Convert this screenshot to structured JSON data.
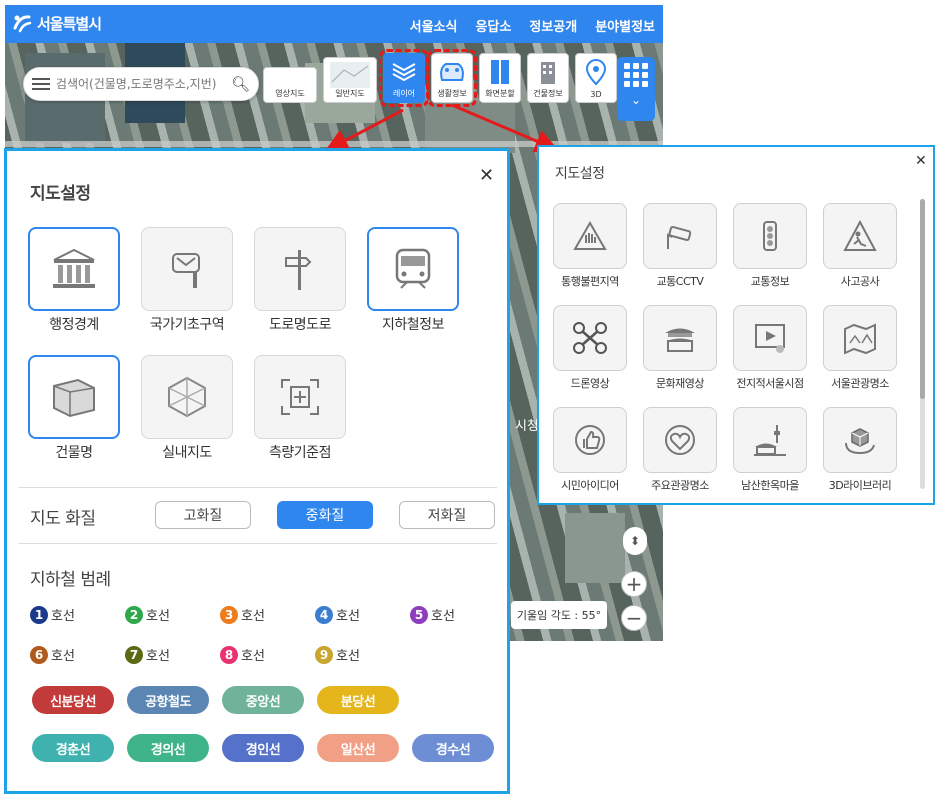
{
  "app": {
    "logo_text": "서울특별시",
    "nav": [
      "서울소식",
      "응답소",
      "정보공개",
      "분야별정보"
    ],
    "search_placeholder": "검색어(건물명,도로명주소,지번)",
    "map_buttons": [
      {
        "label": "영상지도"
      },
      {
        "label": "일반지도"
      },
      {
        "label": "레이어"
      },
      {
        "label": "생활정보"
      },
      {
        "label": "화면분할"
      },
      {
        "label": "건물정보"
      },
      {
        "label": "3D"
      }
    ],
    "tilt_label": "기울임 각도 : 55°",
    "map_text": "시청삼"
  },
  "left_panel": {
    "title": "지도설정",
    "layers": [
      {
        "label": "행정경계",
        "icon": "building-columns-icon",
        "selected": true
      },
      {
        "label": "국가기초구역",
        "icon": "mailbox-icon",
        "selected": false
      },
      {
        "label": "도로명도로",
        "icon": "signpost-icon",
        "selected": false
      },
      {
        "label": "지하철정보",
        "icon": "subway-icon",
        "selected": true
      },
      {
        "label": "건물명",
        "icon": "building-3d-icon",
        "selected": true
      },
      {
        "label": "실내지도",
        "icon": "indoor-cube-icon",
        "selected": false
      },
      {
        "label": "측량기준점",
        "icon": "survey-point-icon",
        "selected": false
      }
    ],
    "quality_title": "지도 화질",
    "quality_options": [
      "고화질",
      "중화질",
      "저화질"
    ],
    "quality_selected": "중화질",
    "legend_title": "지하철 범례",
    "numbered_lines": [
      {
        "num": "1",
        "label": "호선",
        "color": "#1b3a8c"
      },
      {
        "num": "2",
        "label": "호선",
        "color": "#2ea84a"
      },
      {
        "num": "3",
        "label": "호선",
        "color": "#ef7c1c"
      },
      {
        "num": "4",
        "label": "호선",
        "color": "#3b7ed0"
      },
      {
        "num": "5",
        "label": "호선",
        "color": "#8e3dbd"
      },
      {
        "num": "6",
        "label": "호선",
        "color": "#b05a1e"
      },
      {
        "num": "7",
        "label": "호선",
        "color": "#5b6a14"
      },
      {
        "num": "8",
        "label": "호선",
        "color": "#e8336f"
      },
      {
        "num": "9",
        "label": "호선",
        "color": "#c9a62e"
      }
    ],
    "named_lines": [
      {
        "label": "신분당선",
        "color": "#c23a3a"
      },
      {
        "label": "공항철도",
        "color": "#5b86b4"
      },
      {
        "label": "중앙선",
        "color": "#6fb49a"
      },
      {
        "label": "분당선",
        "color": "#e5b51c"
      },
      {
        "label": "경춘선",
        "color": "#3fb2b0"
      },
      {
        "label": "경의선",
        "color": "#3fb489"
      },
      {
        "label": "경인선",
        "color": "#5571c9"
      },
      {
        "label": "일산선",
        "color": "#f2a085"
      },
      {
        "label": "경수선",
        "color": "#6d8ed4"
      }
    ]
  },
  "right_panel": {
    "title": "지도설정",
    "items": [
      {
        "label": "통행불편지역",
        "icon": "warning-hand-icon"
      },
      {
        "label": "교통CCTV",
        "icon": "cctv-icon"
      },
      {
        "label": "교통정보",
        "icon": "traffic-light-icon"
      },
      {
        "label": "사고공사",
        "icon": "construction-icon"
      },
      {
        "label": "드론영상",
        "icon": "drone-icon"
      },
      {
        "label": "문화재영상",
        "icon": "palace-icon"
      },
      {
        "label": "전지적서울시점",
        "icon": "video-play-icon"
      },
      {
        "label": "서울관광명소",
        "icon": "map-panorama-icon"
      },
      {
        "label": "시민아이디어",
        "icon": "thumbs-up-icon"
      },
      {
        "label": "주요관광명소",
        "icon": "heart-icon"
      },
      {
        "label": "남산한옥마을",
        "icon": "namsan-tower-icon"
      },
      {
        "label": "3D라이브러리",
        "icon": "rotate-cube-icon"
      }
    ]
  }
}
